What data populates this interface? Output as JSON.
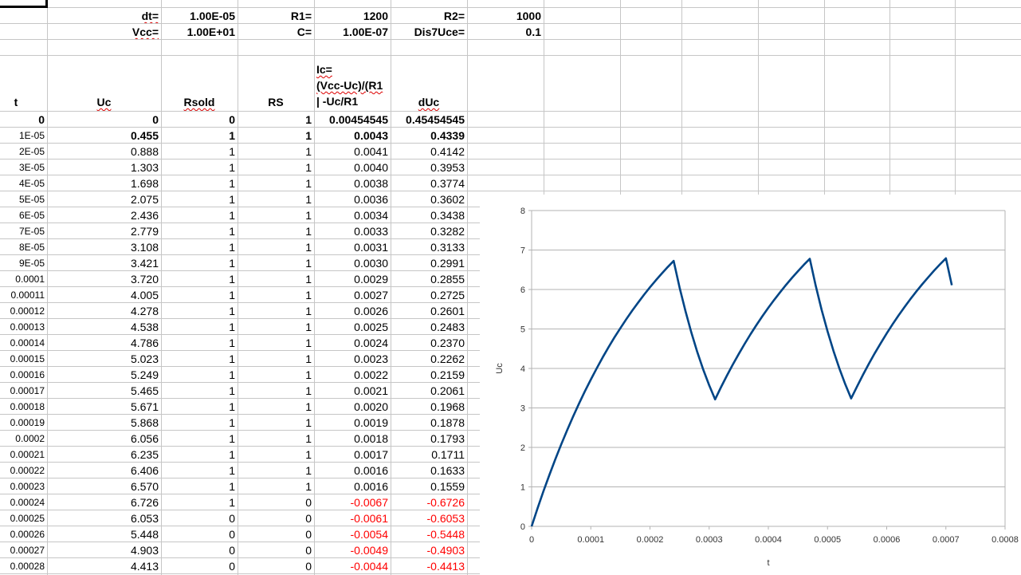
{
  "params": {
    "dt_label": "dt=",
    "dt_value": "1.00E-05",
    "vcc_label": "Vcc=",
    "vcc_value": "1.00E+01",
    "r1_label": "R1=",
    "r1_value": "1200",
    "c_label": "C=",
    "c_value": "1.00E-07",
    "r2_label": "R2=",
    "r2_value": "1000",
    "dis_label": "Dis7Uce=",
    "dis_value": "0.1"
  },
  "headers": {
    "t": "t",
    "uc": "Uc",
    "rsold": "Rsold",
    "rs": "RS",
    "ic_lines": [
      "Ic=",
      "(Vcc-Uc)/(R1",
      "| -Uc/R1"
    ],
    "duc": "dUc"
  },
  "rows": [
    [
      "0",
      "0",
      "0",
      "1",
      "0.00454545",
      "0.45454545"
    ],
    [
      "1E-05",
      "0.455",
      "1",
      "1",
      "0.0043",
      "0.4339"
    ],
    [
      "2E-05",
      "0.888",
      "1",
      "1",
      "0.0041",
      "0.4142"
    ],
    [
      "3E-05",
      "1.303",
      "1",
      "1",
      "0.0040",
      "0.3953"
    ],
    [
      "4E-05",
      "1.698",
      "1",
      "1",
      "0.0038",
      "0.3774"
    ],
    [
      "5E-05",
      "2.075",
      "1",
      "1",
      "0.0036",
      "0.3602"
    ],
    [
      "6E-05",
      "2.436",
      "1",
      "1",
      "0.0034",
      "0.3438"
    ],
    [
      "7E-05",
      "2.779",
      "1",
      "1",
      "0.0033",
      "0.3282"
    ],
    [
      "8E-05",
      "3.108",
      "1",
      "1",
      "0.0031",
      "0.3133"
    ],
    [
      "9E-05",
      "3.421",
      "1",
      "1",
      "0.0030",
      "0.2991"
    ],
    [
      "0.0001",
      "3.720",
      "1",
      "1",
      "0.0029",
      "0.2855"
    ],
    [
      "0.00011",
      "4.005",
      "1",
      "1",
      "0.0027",
      "0.2725"
    ],
    [
      "0.00012",
      "4.278",
      "1",
      "1",
      "0.0026",
      "0.2601"
    ],
    [
      "0.00013",
      "4.538",
      "1",
      "1",
      "0.0025",
      "0.2483"
    ],
    [
      "0.00014",
      "4.786",
      "1",
      "1",
      "0.0024",
      "0.2370"
    ],
    [
      "0.00015",
      "5.023",
      "1",
      "1",
      "0.0023",
      "0.2262"
    ],
    [
      "0.00016",
      "5.249",
      "1",
      "1",
      "0.0022",
      "0.2159"
    ],
    [
      "0.00017",
      "5.465",
      "1",
      "1",
      "0.0021",
      "0.2061"
    ],
    [
      "0.00018",
      "5.671",
      "1",
      "1",
      "0.0020",
      "0.1968"
    ],
    [
      "0.00019",
      "5.868",
      "1",
      "1",
      "0.0019",
      "0.1878"
    ],
    [
      "0.0002",
      "6.056",
      "1",
      "1",
      "0.0018",
      "0.1793"
    ],
    [
      "0.00021",
      "6.235",
      "1",
      "1",
      "0.0017",
      "0.1711"
    ],
    [
      "0.00022",
      "6.406",
      "1",
      "1",
      "0.0016",
      "0.1633"
    ],
    [
      "0.00023",
      "6.570",
      "1",
      "1",
      "0.0016",
      "0.1559"
    ],
    [
      "0.00024",
      "6.726",
      "1",
      "0",
      "-0.0067",
      "-0.6726"
    ],
    [
      "0.00025",
      "6.053",
      "0",
      "0",
      "-0.0061",
      "-0.6053"
    ],
    [
      "0.00026",
      "5.448",
      "0",
      "0",
      "-0.0054",
      "-0.5448"
    ],
    [
      "0.00027",
      "4.903",
      "0",
      "0",
      "-0.0049",
      "-0.4903"
    ],
    [
      "0.00028",
      "4.413",
      "0",
      "0",
      "-0.0044",
      "-0.4413"
    ]
  ],
  "chart_data": {
    "type": "line",
    "title": "",
    "xlabel": "t",
    "ylabel": "Uc",
    "xlim": [
      0,
      0.0008
    ],
    "ylim": [
      0,
      8
    ],
    "xticks": [
      "0",
      "0.0001",
      "0.0002",
      "0.0003",
      "0.0004",
      "0.0005",
      "0.0006",
      "0.0007",
      "0.0008"
    ],
    "yticks": [
      "0",
      "1",
      "2",
      "3",
      "4",
      "5",
      "6",
      "7",
      "8"
    ],
    "grid": "horizontal",
    "color": "#004586",
    "x_step": 1e-05,
    "y": [
      0,
      0.455,
      0.888,
      1.303,
      1.698,
      2.075,
      2.436,
      2.779,
      3.108,
      3.421,
      3.72,
      4.005,
      4.278,
      4.538,
      4.786,
      5.023,
      5.249,
      5.465,
      5.671,
      5.868,
      6.056,
      6.235,
      6.406,
      6.57,
      6.726,
      6.053,
      5.448,
      4.903,
      4.413,
      3.971,
      3.574,
      3.217,
      3.525,
      3.819,
      4.1,
      4.368,
      4.624,
      4.869,
      5.102,
      5.325,
      5.537,
      5.74,
      5.934,
      6.119,
      6.295,
      6.463,
      6.624,
      6.777,
      6.099,
      5.489,
      4.94,
      4.446,
      4.002,
      3.601,
      3.241,
      3.548,
      3.841,
      4.121,
      4.388,
      4.643,
      4.887,
      5.119,
      5.341,
      5.553,
      5.755,
      5.948,
      6.132,
      6.308,
      6.476,
      6.636,
      6.789,
      6.11
    ]
  }
}
